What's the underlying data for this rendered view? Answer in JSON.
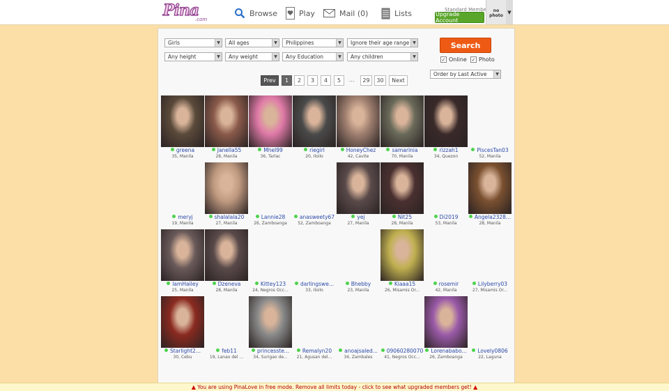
{
  "header": {
    "logo_text": "Pina",
    "logo_sub": ".com",
    "nav": {
      "browse": "Browse",
      "play": "Play",
      "mail": "Mail (0)",
      "lists": "Lists"
    },
    "member_type": "Standard Member",
    "upgrade": "Upgrade Account",
    "avatar": "no photo"
  },
  "filters": {
    "gender": "Girls",
    "ages": "All ages",
    "country": "Philippines",
    "age_range": "Ignore their age range",
    "height": "Any height",
    "weight": "Any weight",
    "education": "Any Education",
    "children": "Any children",
    "order": "Order by Last Active",
    "search_label": "Search",
    "online_label": "Online",
    "photo_label": "Photo"
  },
  "pagination": {
    "prev": "Prev",
    "pages": [
      "1",
      "2",
      "3",
      "4",
      "5"
    ],
    "dots": "...",
    "last_pages": [
      "29",
      "30"
    ],
    "next": "Next"
  },
  "profiles": [
    {
      "name": "greena",
      "loc": "35, Manila",
      "color": "#5a4a3a"
    },
    {
      "name": "Janella55",
      "loc": "28, Manila",
      "color": "#8a5a4a"
    },
    {
      "name": "Mhel99",
      "loc": "36, Tarlac",
      "color": "#e07aa8"
    },
    {
      "name": "riegirl",
      "loc": "20, Iloilo",
      "color": "#4a4a4a"
    },
    {
      "name": "HoneyChez",
      "loc": "42, Cavite",
      "color": "#a08070"
    },
    {
      "name": "samarinia",
      "loc": "70, Manila",
      "color": "#6a6a5a"
    },
    {
      "name": "rizzah1",
      "loc": "34, Quezon",
      "color": "#3a2a2a"
    },
    {
      "name": "PiscesTan03",
      "loc": "52, Manila",
      "color": ""
    },
    {
      "name": "meryj",
      "loc": "19, Manila",
      "color": ""
    },
    {
      "name": "shalalala20",
      "loc": "27, Manila",
      "color": "#c09a80"
    },
    {
      "name": "Lannie28",
      "loc": "26, Zamboanga",
      "color": ""
    },
    {
      "name": "anasweety67",
      "loc": "52, Zamboanga",
      "color": ""
    },
    {
      "name": "yej",
      "loc": "27, Manila",
      "color": "#5a4a4a"
    },
    {
      "name": "Nit25",
      "loc": "28, Manila",
      "color": "#4a3030"
    },
    {
      "name": "Di2019",
      "loc": "53, Manila",
      "color": ""
    },
    {
      "name": "Angela2328...",
      "loc": "28, Manila",
      "color": "#7a5030"
    },
    {
      "name": "IamHailey",
      "loc": "25, Manila",
      "color": "#6a5a5a"
    },
    {
      "name": "Dzeneva",
      "loc": "28, Manila",
      "color": "#5a4a4a"
    },
    {
      "name": "Kittey123",
      "loc": "24, Negros Occ...",
      "color": ""
    },
    {
      "name": "darlingswe...",
      "loc": "33, Iloilo",
      "color": ""
    },
    {
      "name": "Bhebby",
      "loc": "23, Manila",
      "color": ""
    },
    {
      "name": "Kiaaa15",
      "loc": "26, Misamis Or...",
      "color": "#c0b050"
    },
    {
      "name": "rosemir",
      "loc": "42, Manila",
      "color": ""
    },
    {
      "name": "Lilyberry03",
      "loc": "27, Misamis Or...",
      "color": ""
    },
    {
      "name": "Starlight2...",
      "loc": "30, Cebu",
      "color": "#8a2a20"
    },
    {
      "name": "feb11",
      "loc": "19, Lanao del ...",
      "color": ""
    },
    {
      "name": "princesste...",
      "loc": "34, Surigao de...",
      "color": "#8a8a8a"
    },
    {
      "name": "Remalyn20",
      "loc": "21, Agusan del...",
      "color": ""
    },
    {
      "name": "anoajsaled...",
      "loc": "34, Zambales",
      "color": ""
    },
    {
      "name": "09060280070",
      "loc": "41, Negros Occ...",
      "color": ""
    },
    {
      "name": "Lorenababo...",
      "loc": "26, Zamboanga",
      "color": "#9a5aa8"
    },
    {
      "name": "Lovely0806",
      "loc": "22, Laguna",
      "color": ""
    }
  ],
  "banner": "You are using PinaLove in free mode. Remove all limits today - click to see what upgraded members get!"
}
